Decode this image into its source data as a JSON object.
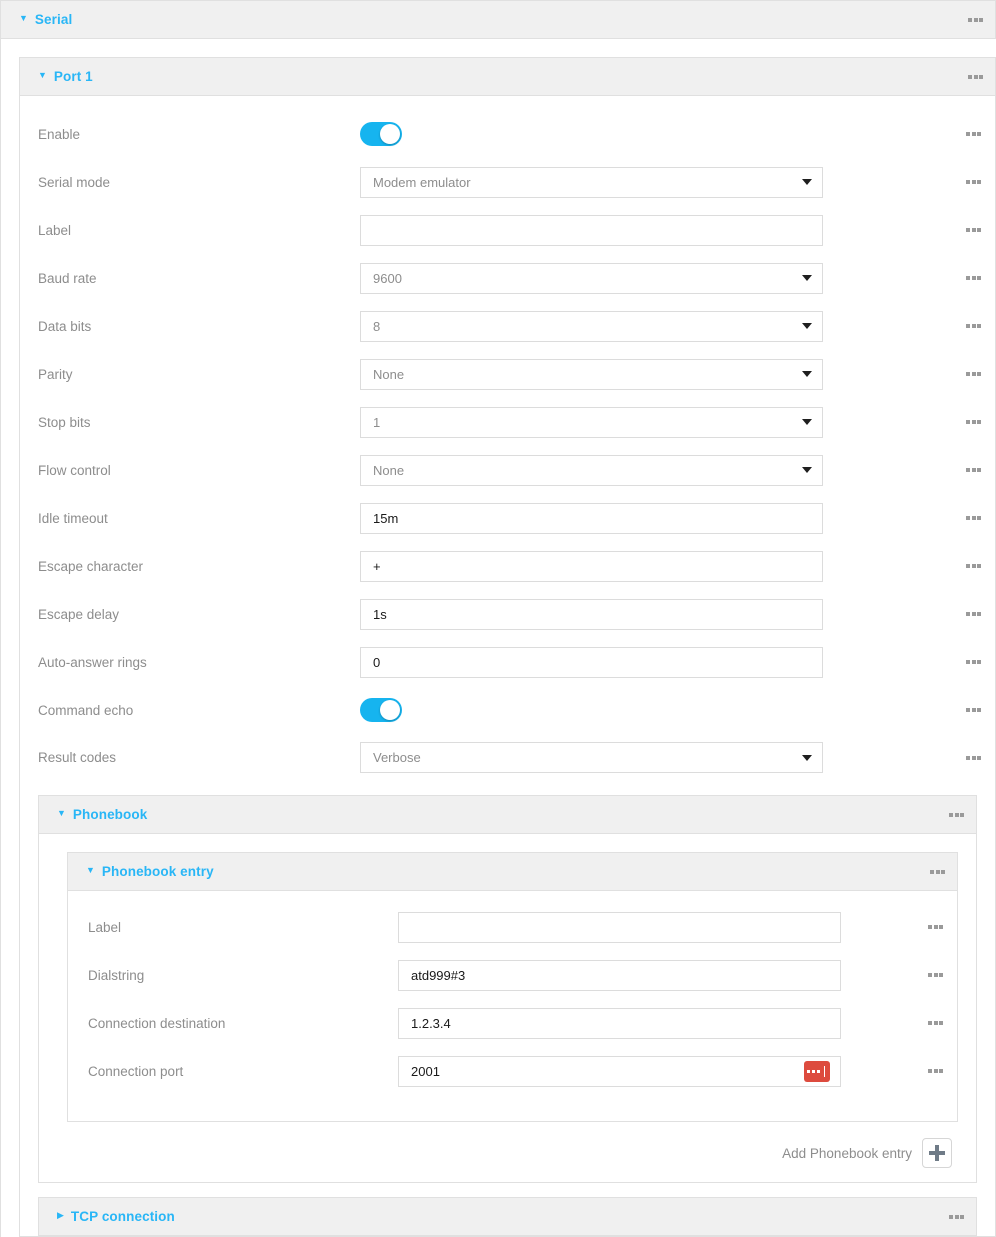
{
  "serial": {
    "title": "Serial",
    "expanded": true,
    "caret": "caret-down-icon",
    "menu_icon": "kebab-menu-icon"
  },
  "port1": {
    "title": "Port 1",
    "expanded": true,
    "caret": "caret-down-icon",
    "fields": [
      {
        "label": "Enable",
        "type": "toggle",
        "value": "on"
      },
      {
        "label": "Serial mode",
        "type": "select",
        "value": "Modem emulator"
      },
      {
        "label": "Label",
        "type": "text",
        "value": ""
      },
      {
        "label": "Baud rate",
        "type": "select",
        "value": "9600"
      },
      {
        "label": "Data bits",
        "type": "select",
        "value": "8"
      },
      {
        "label": "Parity",
        "type": "select",
        "value": "None"
      },
      {
        "label": "Stop bits",
        "type": "select",
        "value": "1"
      },
      {
        "label": "Flow control",
        "type": "select",
        "value": "None"
      },
      {
        "label": "Idle timeout",
        "type": "text",
        "value": "15m"
      },
      {
        "label": "Escape character",
        "type": "text",
        "value": "+"
      },
      {
        "label": "Escape delay",
        "type": "text",
        "value": "1s"
      },
      {
        "label": "Auto-answer rings",
        "type": "text",
        "value": "0"
      },
      {
        "label": "Command echo",
        "type": "toggle",
        "value": "on"
      },
      {
        "label": "Result codes",
        "type": "select",
        "value": "Verbose"
      }
    ]
  },
  "phonebook": {
    "title": "Phonebook",
    "expanded": true,
    "add_label": "Add Phonebook entry",
    "add_icon": "plus-icon",
    "entry": {
      "title": "Phonebook entry",
      "expanded": true,
      "fields": [
        {
          "label": "Label",
          "type": "text",
          "value": ""
        },
        {
          "label": "Dialstring",
          "type": "text",
          "value": "atd999#3"
        },
        {
          "label": "Connection destination",
          "type": "text",
          "value": "1.2.3.4"
        },
        {
          "label": "Connection port",
          "type": "text",
          "value": "2001",
          "action_icon": "red-ellipsis-button"
        }
      ]
    }
  },
  "tcp": {
    "title": "TCP connection",
    "expanded": false,
    "caret": "caret-right-icon"
  },
  "colors": {
    "accent": "#29b6f6",
    "toggle_on": "#16b4ef",
    "label_text": "#8d8d8d",
    "value_text": "#1a1a1a",
    "header_bg": "#f0f0f0",
    "border": "#e0e0e0",
    "danger": "#dd4b3e"
  }
}
